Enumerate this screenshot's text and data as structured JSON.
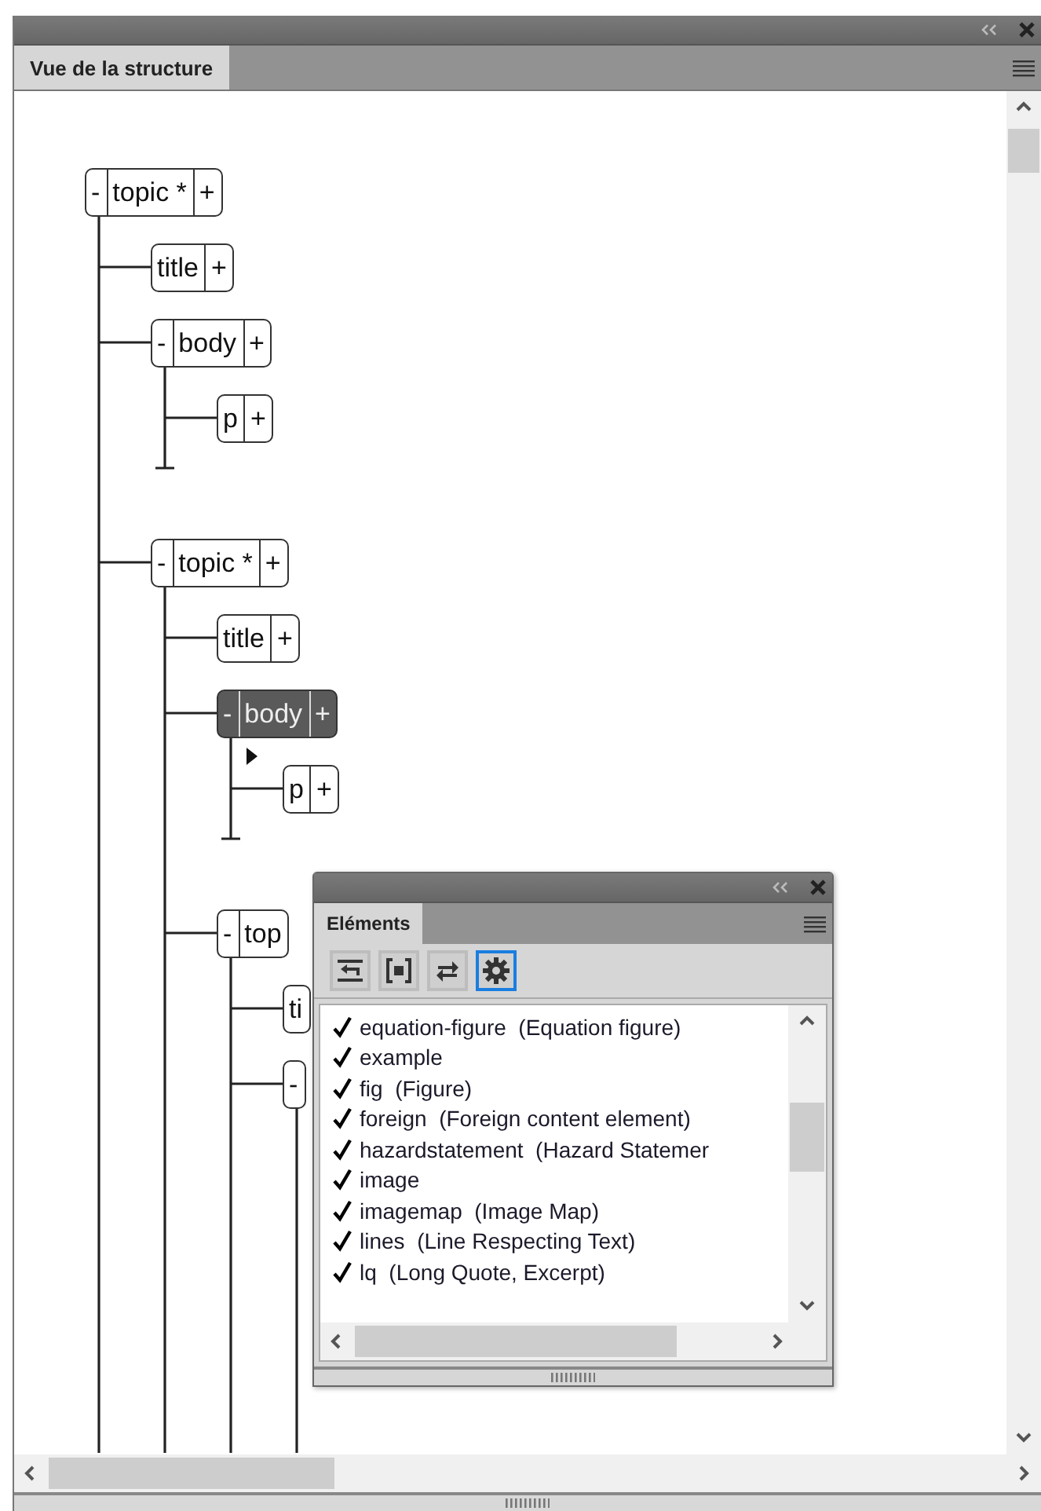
{
  "structure_panel": {
    "tab": {
      "label": "Vue de la structure",
      "selected": true
    },
    "tree": [
      {
        "toggle": "-",
        "label": "topic *",
        "add": "+",
        "selected": false,
        "children": [
          {
            "label": "title",
            "add": "+",
            "selected": false
          },
          {
            "toggle": "-",
            "label": "body",
            "add": "+",
            "selected": false,
            "children": [
              {
                "label": "p",
                "add": "+",
                "selected": false
              }
            ]
          },
          {
            "toggle": "-",
            "label": "topic *",
            "add": "+",
            "selected": false,
            "children": [
              {
                "label": "title",
                "add": "+",
                "selected": false
              },
              {
                "toggle": "-",
                "label": "body",
                "add": "+",
                "selected": true,
                "children": [
                  {
                    "label": "p",
                    "add": "+",
                    "selected": false
                  }
                ]
              },
              {
                "toggle": "-",
                "label": "top",
                "selected": false,
                "children": [
                  {
                    "label": "ti",
                    "selected": false
                  },
                  {
                    "toggle": "-",
                    "selected": false
                  }
                ]
              }
            ]
          }
        ]
      }
    ]
  },
  "elements_panel": {
    "tab": {
      "label": "Eléments",
      "selected": true
    },
    "tools": [
      {
        "selected": false
      },
      {
        "selected": false
      },
      {
        "selected": false
      },
      {
        "selected": true
      }
    ],
    "items": [
      {
        "text": "equation-figure  (Equation figure)",
        "checked": true
      },
      {
        "text": "example",
        "checked": true
      },
      {
        "text": "fig  (Figure)",
        "checked": true
      },
      {
        "text": "foreign  (Foreign content element)",
        "checked": true
      },
      {
        "text": "hazardstatement  (Hazard Statemer",
        "checked": true
      },
      {
        "text": "image",
        "checked": true
      },
      {
        "text": "imagemap  (Image Map)",
        "checked": true
      },
      {
        "text": "lines  (Line Respecting Text)",
        "checked": true
      },
      {
        "text": "lq  (Long Quote, Excerpt)",
        "checked": true
      }
    ]
  }
}
